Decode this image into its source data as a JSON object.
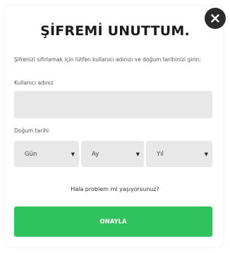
{
  "modal": {
    "title": "ŞİFREMİ UNUTTUM.",
    "instructions": "Şifrenizi sıfırlamak için lütfen kullanıcı adınızı ve doğum tarihinizi girin:",
    "username": {
      "label": "Kullanıcı adınız",
      "value": ""
    },
    "birthdate": {
      "label": "Doğum tarihi",
      "day": "Gün",
      "month": "Ay",
      "year": "Yıl",
      "caret": "▼"
    },
    "help_link": "Hala problem mi yaşıyorsunuz?",
    "confirm_label": "ONAYLA",
    "close_icon": "close-icon"
  },
  "colors": {
    "accent_green": "#2fc25d",
    "close_bg": "#2b2b2b",
    "field_bg": "#e8e8e8"
  }
}
